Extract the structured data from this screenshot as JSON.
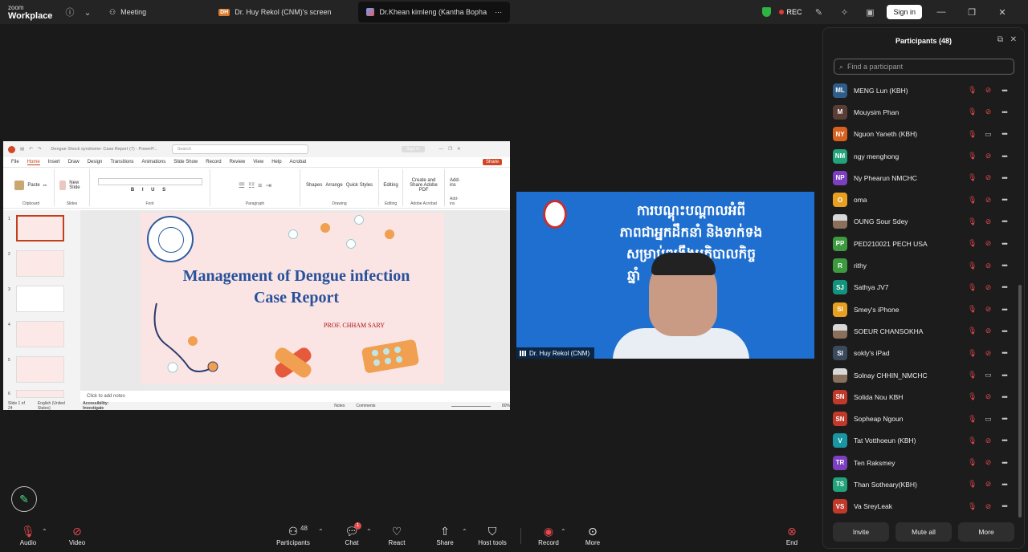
{
  "app": {
    "logo_top": "zoom",
    "logo_bottom": "Workplace"
  },
  "topbar": {
    "tabs": [
      {
        "label": "Meeting"
      },
      {
        "badge": "DH",
        "label": "Dr. Huy Rekol (CNM)'s screen"
      },
      {
        "label": "Dr.Khean kimleng (Kantha Bopha"
      }
    ],
    "rec_label": "REC",
    "signin_label": "Sign in"
  },
  "powerpoint": {
    "title": "Dengue Shock syndrome- Case Report (7) - PowerP...",
    "search_placeholder": "Search",
    "signin": "Sign in",
    "menu": [
      "File",
      "Home",
      "Insert",
      "Draw",
      "Design",
      "Transitions",
      "Animations",
      "Slide Show",
      "Record",
      "Review",
      "View",
      "Help",
      "Acrobat"
    ],
    "share_label": "Share",
    "ribbon_groups": [
      "Clipboard",
      "Slides",
      "Font",
      "Paragraph",
      "Drawing",
      "Editing",
      "Adobe Acrobat",
      "Add-ins"
    ],
    "ribbon_buttons": {
      "paste": "Paste",
      "new_slide": "New Slide",
      "shapes": "Shapes",
      "arrange": "Arrange",
      "quick_styles": "Quick Styles",
      "editing": "Editing",
      "create_pdf": "Create and Share Adobe PDF",
      "addins": "Add-ins"
    },
    "thumb_numbers": [
      "1",
      "2",
      "3",
      "4",
      "5",
      "6"
    ],
    "slide": {
      "title_line1": "Management of Dengue infection",
      "title_line2": "Case Report",
      "author": "PROF. CHHAM SARY"
    },
    "notes_placeholder": "Click to add notes",
    "status": {
      "slide_count": "Slide 1 of 24",
      "language": "English (United States)",
      "accessibility": "Accessibility: Investigate",
      "notes": "Notes",
      "comments": "Comments",
      "zoom": "80%"
    }
  },
  "video": {
    "banner_line1": "ការបណ្តុះបណ្តាលអំពី",
    "banner_line2": "ភាពជាអ្នកដឹកនាំ និងទាក់ទង",
    "banner_line3": "សម្រាប់ពង្រឹងអភិបាលកិច្ច",
    "banner_line4": "ឆ្នាំ",
    "name": "Dr. Huy Rekol (CNM)"
  },
  "participants": {
    "title": "Participants (48)",
    "search_placeholder": "Find a participant",
    "list": [
      {
        "initials": "ML",
        "name": "MENG Lun (KBH)",
        "color": "#2f5d8a",
        "cam": "off"
      },
      {
        "initials": "M",
        "name": "Mouysim Phan",
        "color": "#5a3e36",
        "cam": "off"
      },
      {
        "initials": "NY",
        "name": "Nguon Yaneth (KBH)",
        "color": "#d9611f",
        "cam": "on"
      },
      {
        "initials": "NM",
        "name": "ngy menghong",
        "color": "#22a37a",
        "cam": "off"
      },
      {
        "initials": "NP",
        "name": "Ny Phearun NMCHC",
        "color": "#7b3fbf",
        "cam": "off"
      },
      {
        "initials": "O",
        "name": "oma",
        "color": "#e8a020",
        "cam": "off"
      },
      {
        "initials": "",
        "name": "OUNG Sour Sdey",
        "color": "photo",
        "cam": "off"
      },
      {
        "initials": "PP",
        "name": "PED210021 PECH USA",
        "color": "#3d9a3f",
        "cam": "off"
      },
      {
        "initials": "R",
        "name": "rithy",
        "color": "#3d9a3f",
        "cam": "off"
      },
      {
        "initials": "SJ",
        "name": "Sathya JV7",
        "color": "#12947f",
        "cam": "off"
      },
      {
        "initials": "SI",
        "name": "Smey's iPhone",
        "color": "#e8a020",
        "cam": "off"
      },
      {
        "initials": "",
        "name": "SOEUR CHANSOKHA",
        "color": "photo",
        "cam": "off"
      },
      {
        "initials": "SI",
        "name": "sokly's iPad",
        "color": "#3a4a5c",
        "cam": "off"
      },
      {
        "initials": "",
        "name": "Solnay CHHIN_NMCHC",
        "color": "photo",
        "cam": "on"
      },
      {
        "initials": "SN",
        "name": "Solida Nou KBH",
        "color": "#c0392b",
        "cam": "off"
      },
      {
        "initials": "SN",
        "name": "Sopheap Ngoun",
        "color": "#c0392b",
        "cam": "on"
      },
      {
        "initials": "V",
        "name": "Tat Votthoeun (KBH)",
        "color": "#1996a3",
        "cam": "off"
      },
      {
        "initials": "TR",
        "name": "Ten Raksmey",
        "color": "#7b3fbf",
        "cam": "off"
      },
      {
        "initials": "TS",
        "name": "Than Sotheary(KBH)",
        "color": "#22a37a",
        "cam": "off"
      },
      {
        "initials": "VS",
        "name": "Va SreyLeak",
        "color": "#c0392b",
        "cam": "off"
      }
    ],
    "footer": {
      "invite": "Invite",
      "mute_all": "Mute all",
      "more": "More"
    }
  },
  "toolbar": {
    "audio": "Audio",
    "video": "Video",
    "participants": "Participants",
    "participants_count": "48",
    "chat": "Chat",
    "chat_badge": "1",
    "react": "React",
    "share": "Share",
    "host_tools": "Host tools",
    "record": "Record",
    "more": "More",
    "end": "End"
  }
}
